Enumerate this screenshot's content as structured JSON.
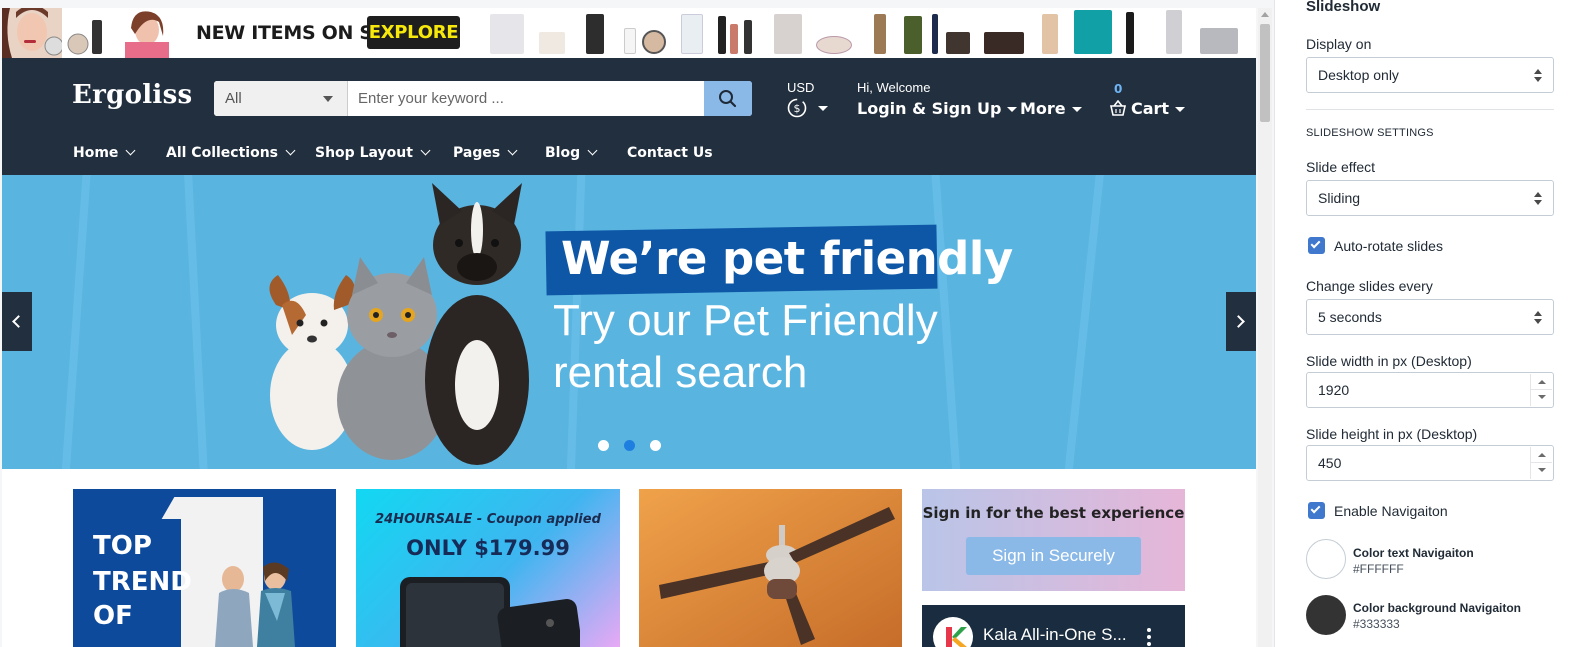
{
  "promo": {
    "text": "NEW ITEMS ON SHOP",
    "button": "EXPLORE"
  },
  "header": {
    "logo": "Ergoliss",
    "search": {
      "category": "All",
      "placeholder": "Enter your keyword ..."
    },
    "currency_label": "USD",
    "welcome": "Hi, Welcome",
    "login": "Login & Sign Up",
    "more": "More",
    "cart_count": "0",
    "cart": "Cart",
    "nav": [
      "Home",
      "All Collections",
      "Shop Layout",
      "Pages",
      "Blog",
      "Contact Us"
    ]
  },
  "slideshow": {
    "headline": "We’re pet friendly",
    "line1": "Try our Pet Friendly",
    "line2": "rental search",
    "active_dot": 2
  },
  "banners": {
    "trend": [
      "TOP",
      "TREND",
      "OF"
    ],
    "coupon": "24HOURSALE - Coupon applied",
    "price": "ONLY $179.99",
    "signin_message": "Sign in for the best experience",
    "signin_button": "Sign in Securely",
    "video_title": "Kala All-in-One S..."
  },
  "panel": {
    "title": "Slideshow",
    "display_on_label": "Display on",
    "display_on_value": "Desktop only",
    "section_heading": "SLIDESHOW SETTINGS",
    "slide_effect_label": "Slide effect",
    "slide_effect_value": "Sliding",
    "auto_rotate_label": "Auto-rotate slides",
    "auto_rotate_checked": true,
    "change_every_label": "Change slides every",
    "change_every_value": "5 seconds",
    "width_label": "Slide width in px (Desktop)",
    "width_value": "1920",
    "height_label": "Slide height in px (Desktop)",
    "height_value": "450",
    "nav_label": "Enable Navigaiton",
    "nav_checked": true,
    "color_text_label": "Color text Navigaiton",
    "color_text_value": "#FFFFFF",
    "color_bg_label": "Color background Navigaiton",
    "color_bg_value": "#333333"
  },
  "colors": {
    "header_bg": "#222f3e",
    "accent_blue": "#8ab9e8",
    "slide_bg": "#5ab4e0",
    "checkbox": "#3f78cc"
  }
}
